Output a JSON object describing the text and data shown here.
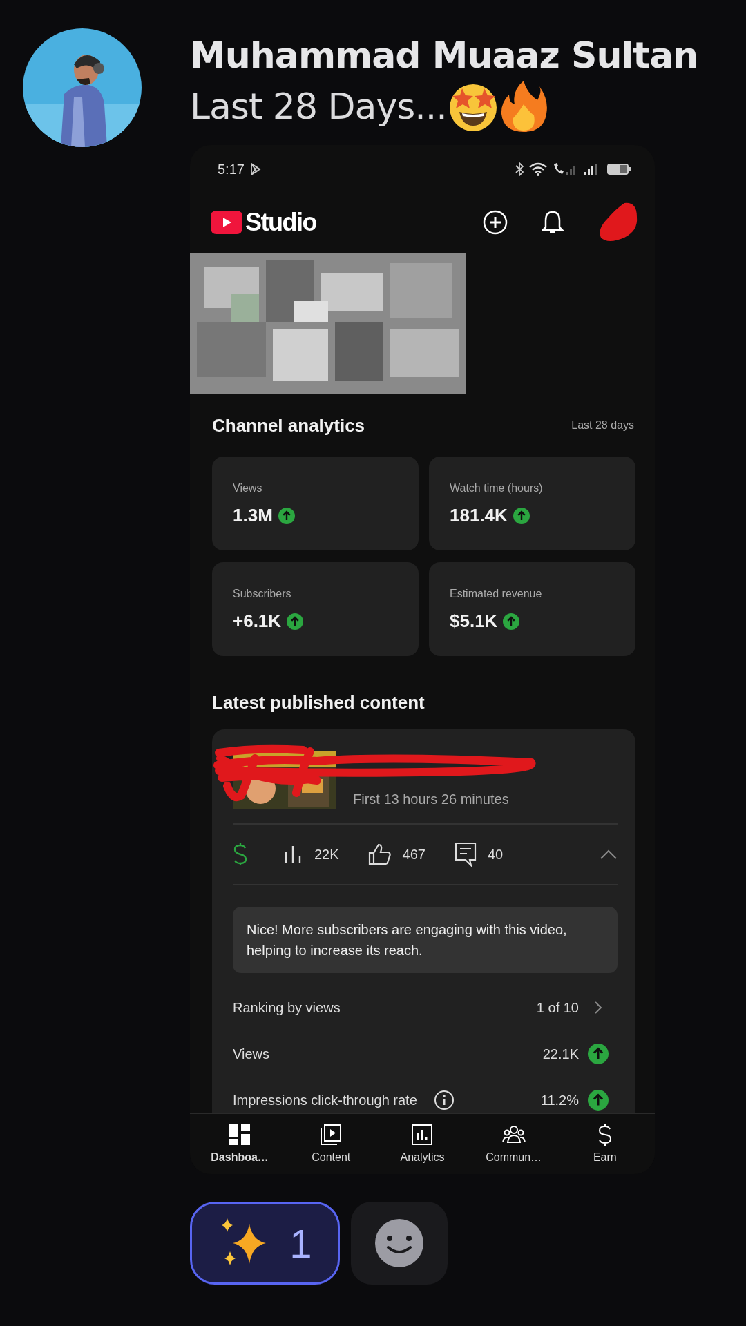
{
  "message": {
    "author": "Muhammad Muaaz Sultan",
    "text": "Last 28 Days..."
  },
  "phone": {
    "status_bar": {
      "time": "5:17"
    },
    "app_title": "Studio",
    "channel_analytics": {
      "title": "Channel analytics",
      "period": "Last 28 days",
      "metrics": [
        {
          "label": "Views",
          "value": "1.3M"
        },
        {
          "label": "Watch time (hours)",
          "value": "181.4K"
        },
        {
          "label": "Subscribers",
          "value": "+6.1K"
        },
        {
          "label": "Estimated revenue",
          "value": "$5.1K"
        }
      ]
    },
    "latest_content": {
      "title": "Latest published content",
      "video": {
        "subtitle": "First 13 hours 26 minutes",
        "expanded": true,
        "stats": [
          {
            "kind": "revenue"
          },
          {
            "kind": "views",
            "value": "22K"
          },
          {
            "kind": "likes",
            "value": "467"
          },
          {
            "kind": "comments",
            "value": "40"
          }
        ],
        "tip": "Nice! More subscribers are engaging with this video, helping to increase its reach.",
        "rows": [
          {
            "kind": "link",
            "label": "Ranking by views",
            "value": "1 of 10"
          },
          {
            "kind": "trend",
            "label": "Views",
            "value": "22.1K"
          },
          {
            "kind": "trend",
            "label": "Impressions click-through rate",
            "value": "11.2%",
            "info": true
          }
        ]
      }
    },
    "nav": [
      {
        "label": "Dashboa…",
        "selected": true
      },
      {
        "label": "Content",
        "selected": false
      },
      {
        "label": "Analytics",
        "selected": false
      },
      {
        "label": "Commun…",
        "selected": false
      },
      {
        "label": "Earn",
        "selected": false
      }
    ]
  },
  "reactions": [
    {
      "kind": "emoji",
      "count": "1",
      "selected": true
    },
    {
      "kind": "add"
    }
  ]
}
